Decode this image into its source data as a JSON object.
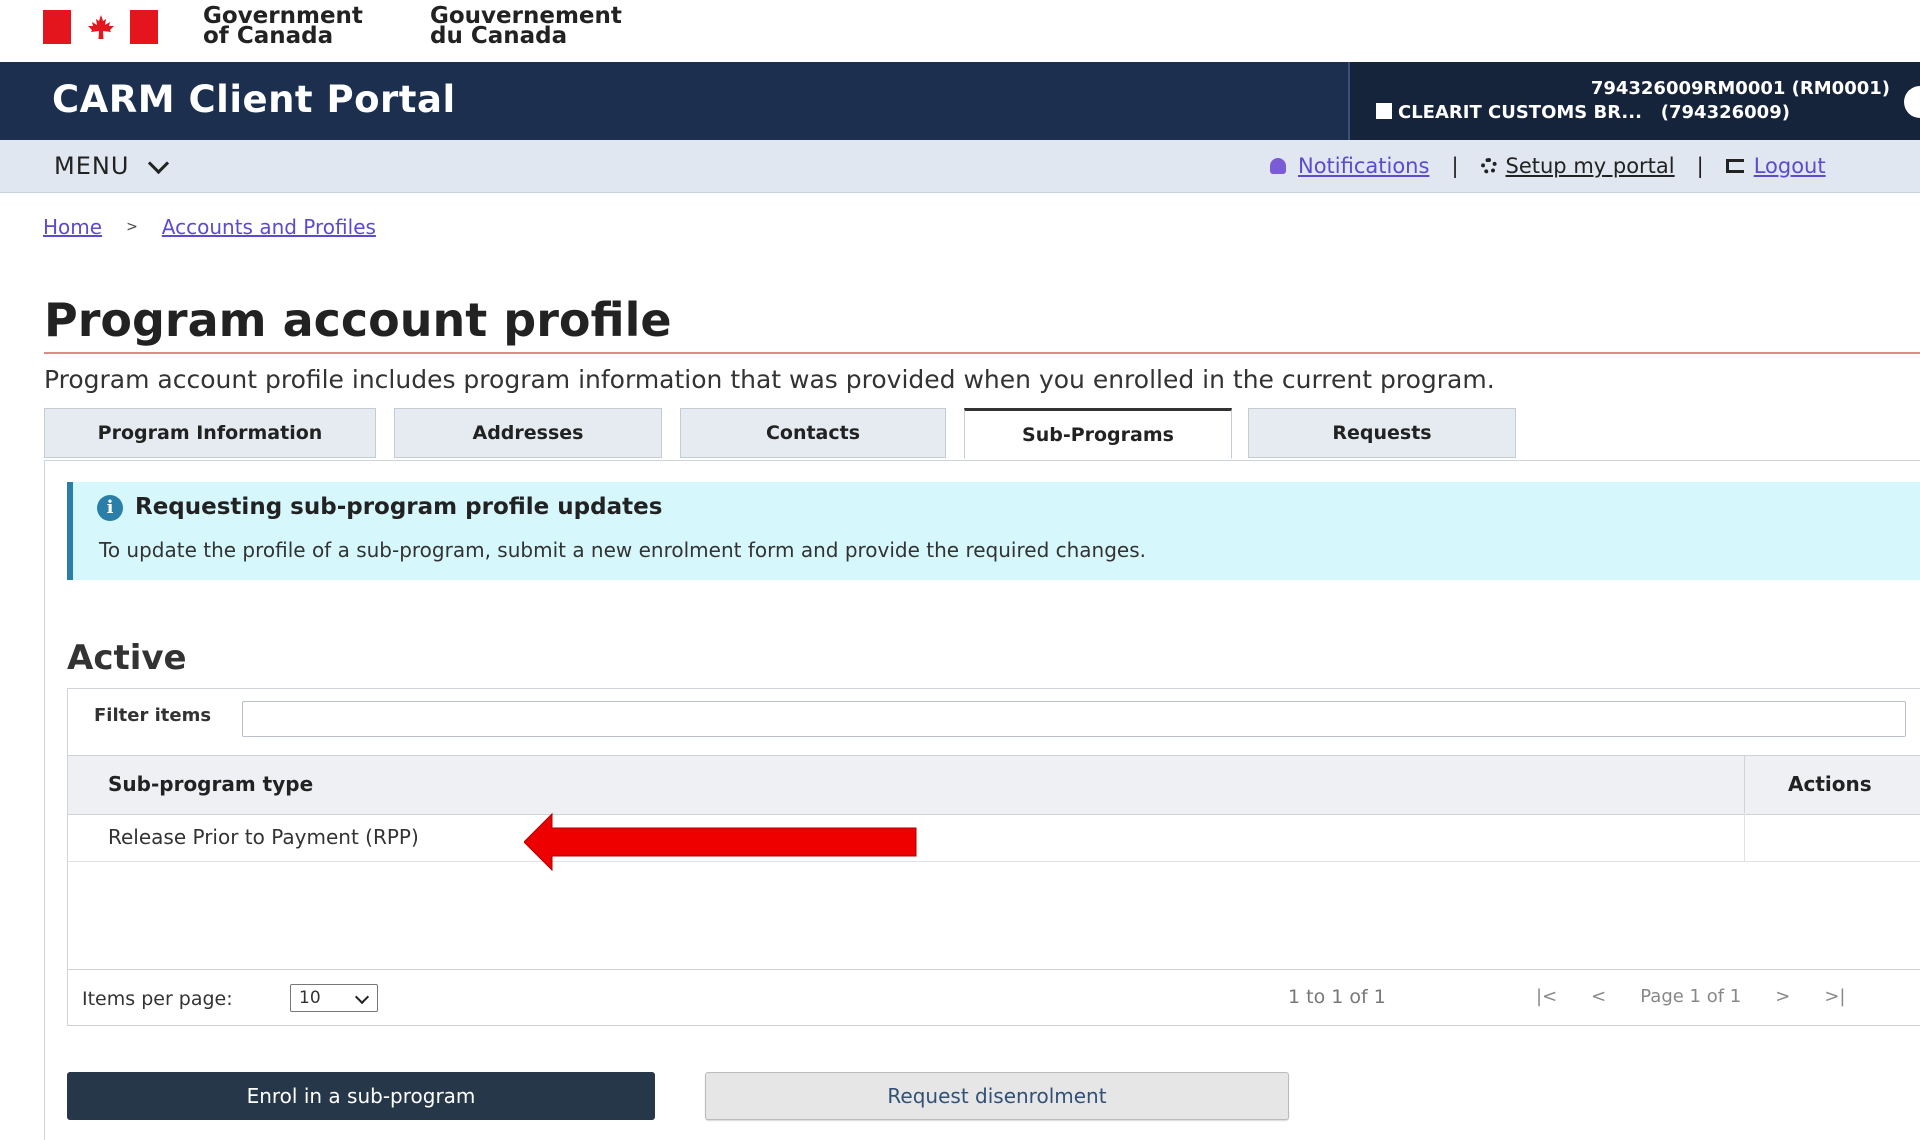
{
  "gov": {
    "en_line1": "Government",
    "en_line2": "of Canada",
    "fr_line1": "Gouvernement",
    "fr_line2": "du Canada"
  },
  "header": {
    "title": "CARM Client Portal",
    "account_id": "794326009RM0001 (RM0001)",
    "business_name": "CLEARIT CUSTOMS BR...",
    "business_number": "(794326009)"
  },
  "menu": {
    "label": "MENU",
    "notifications": "Notifications",
    "setup": "Setup my portal",
    "logout": "Logout"
  },
  "breadcrumb": {
    "home": "Home",
    "sep": ">",
    "accounts": "Accounts and Profiles"
  },
  "page": {
    "title": "Program account profile",
    "description": "Program account profile includes program information that was provided when you enrolled in the current program."
  },
  "tabs": [
    "Program Information",
    "Addresses",
    "Contacts",
    "Sub-Programs",
    "Requests"
  ],
  "active_tab": "Sub-Programs",
  "alert": {
    "title": "Requesting sub-program profile updates",
    "body": "To update the profile of a sub-program, submit a new enrolment form and provide the required changes."
  },
  "active_section": {
    "heading": "Active",
    "filter_label": "Filter items",
    "filter_value": "",
    "columns": [
      "Sub-program type",
      "Actions"
    ],
    "rows": [
      {
        "type": "Release Prior to Payment (RPP)",
        "actions": ""
      }
    ],
    "items_per_page_label": "Items per page:",
    "items_per_page": "10",
    "range": "1 to 1 of 1",
    "first": "|<",
    "prev": "<",
    "page_label": "Page 1 of 1",
    "next": ">",
    "last": ">|"
  },
  "buttons": {
    "enrol": "Enrol in a sub-program",
    "disenrol": "Request disenrolment"
  },
  "colors": {
    "header_bg": "#1c2f4e",
    "flag_red": "#e4151c",
    "link": "#5a4bd1",
    "alert_bg": "#d6f7fb",
    "arrow": "#ee0000"
  }
}
